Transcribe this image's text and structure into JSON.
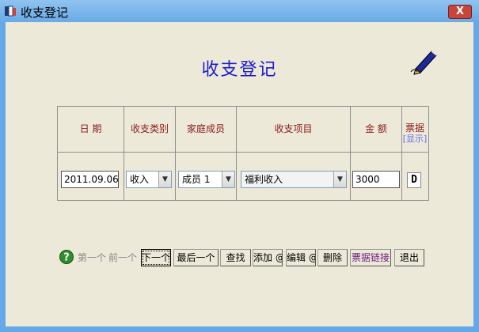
{
  "window": {
    "title": "收支登记",
    "close_label": "X"
  },
  "form": {
    "heading": "收支登记"
  },
  "grid": {
    "headers": {
      "date": "日 期",
      "type": "收支类别",
      "member": "家庭成员",
      "item": "收支项目",
      "amount": "金 额",
      "receipt": "票据",
      "receipt_show": "[显示]"
    },
    "row": {
      "date": "2011.09.06",
      "type": "收入",
      "member": "成员 1",
      "item": "福利收入",
      "amount": "3000",
      "receipt_button": "D"
    }
  },
  "toolbar": {
    "first": "第一个",
    "prev": "前一个",
    "next": "下一个",
    "last": "最后一个",
    "find": "查找",
    "add": "添加 @",
    "edit": "编辑 @",
    "delete": "删除",
    "receipt_link": "票据链接",
    "exit": "退出"
  },
  "icons": {
    "app": "app-icon",
    "pen": "pen-icon",
    "help": "help-icon",
    "dropdown": "chevron-down-icon"
  },
  "colors": {
    "titlebar": "#6aaae6",
    "client_bg": "#ece9d8",
    "heading": "#1a1ad0",
    "header_text": "#8b1a1a"
  }
}
